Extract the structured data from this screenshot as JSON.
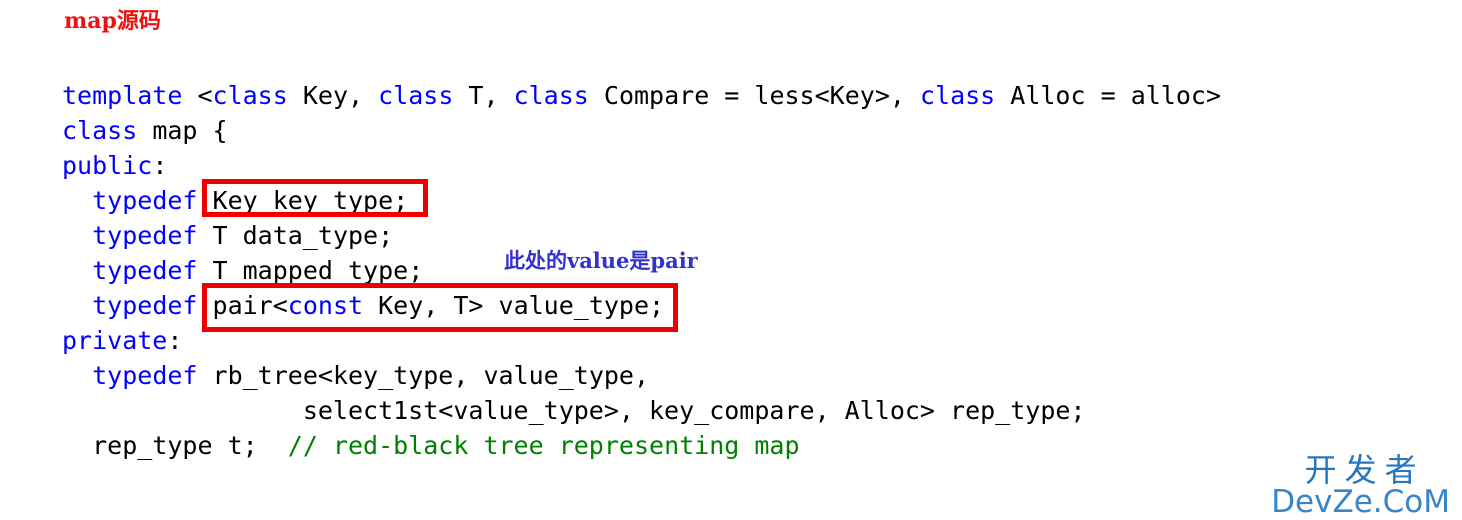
{
  "title": "map源码",
  "code": {
    "lines": [
      [
        {
          "t": "template ",
          "c": "kw"
        },
        {
          "t": "<",
          "c": "id"
        },
        {
          "t": "class ",
          "c": "kw"
        },
        {
          "t": "Key, ",
          "c": "id"
        },
        {
          "t": "class ",
          "c": "kw"
        },
        {
          "t": "T, ",
          "c": "id"
        },
        {
          "t": "class ",
          "c": "kw"
        },
        {
          "t": "Compare = less<Key>, ",
          "c": "id"
        },
        {
          "t": "class ",
          "c": "kw"
        },
        {
          "t": "Alloc = alloc>",
          "c": "id"
        }
      ],
      [
        {
          "t": "class ",
          "c": "kw"
        },
        {
          "t": "map {",
          "c": "id"
        }
      ],
      [
        {
          "t": "public",
          "c": "kw"
        },
        {
          "t": ":",
          "c": "id"
        }
      ],
      [
        {
          "t": "  ",
          "c": "id"
        },
        {
          "t": "typedef ",
          "c": "kw"
        },
        {
          "t": "Key key_type;",
          "c": "id"
        }
      ],
      [
        {
          "t": "  ",
          "c": "id"
        },
        {
          "t": "typedef ",
          "c": "kw"
        },
        {
          "t": "T data_type;",
          "c": "id"
        }
      ],
      [
        {
          "t": "  ",
          "c": "id"
        },
        {
          "t": "typedef ",
          "c": "kw"
        },
        {
          "t": "T mapped_type;",
          "c": "id"
        }
      ],
      [
        {
          "t": "  ",
          "c": "id"
        },
        {
          "t": "typedef ",
          "c": "kw"
        },
        {
          "t": "pair<",
          "c": "id"
        },
        {
          "t": "const ",
          "c": "kw"
        },
        {
          "t": "Key, T> value_type;",
          "c": "id"
        }
      ],
      [
        {
          "t": "private",
          "c": "kw"
        },
        {
          "t": ":",
          "c": "id"
        }
      ],
      [
        {
          "t": "  ",
          "c": "id"
        },
        {
          "t": "typedef ",
          "c": "kw"
        },
        {
          "t": "rb_tree<key_type, value_type,",
          "c": "id"
        }
      ],
      [
        {
          "t": "                select1st<value_type>, key_compare, Alloc> rep_type;",
          "c": "id"
        }
      ],
      [
        {
          "t": "  rep_type t;  ",
          "c": "id"
        },
        {
          "t": "// red-black tree representing map",
          "c": "cmt"
        }
      ]
    ]
  },
  "annotations": {
    "value_pair": "此处的value是pair"
  },
  "highlights": {
    "key_type_label": "Key key_type;",
    "value_type_label": "pair<const Key, T> value_type;"
  },
  "watermark": {
    "cn": "开发者",
    "en": "DevZe.CoM"
  },
  "colors": {
    "title": "#ee1111",
    "keyword": "#0000ff",
    "identifier": "#000000",
    "comment": "#008000",
    "highlight_border": "#ee0000",
    "annotation": "#3333cc",
    "watermark": "#1b6fbd"
  }
}
